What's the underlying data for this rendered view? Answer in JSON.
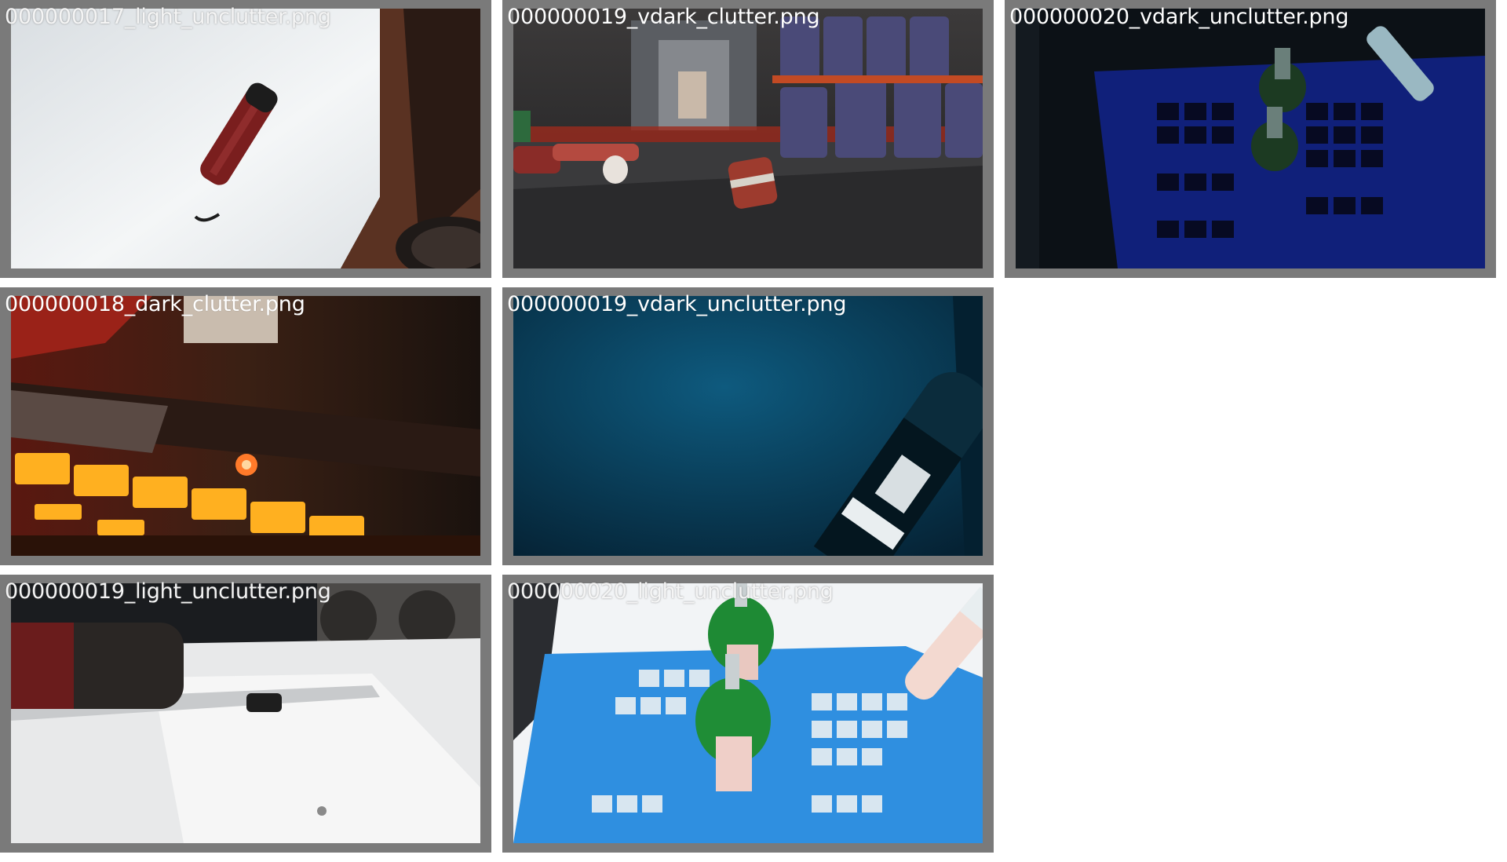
{
  "thumbnails": [
    {
      "filename": "000000017_light_unclutter.png"
    },
    {
      "filename": "000000019_vdark_clutter.png"
    },
    {
      "filename": "000000020_vdark_unclutter.png"
    },
    {
      "filename": "000000018_dark_clutter.png"
    },
    {
      "filename": "000000019_vdark_unclutter.png"
    },
    {
      "filename": "000000019_light_unclutter.png"
    },
    {
      "filename": "000000020_light_unclutter.png"
    }
  ],
  "colors": {
    "tile_border": "#7a7a7a",
    "label_text": "#ffffff",
    "page_background": "#ffffff"
  }
}
